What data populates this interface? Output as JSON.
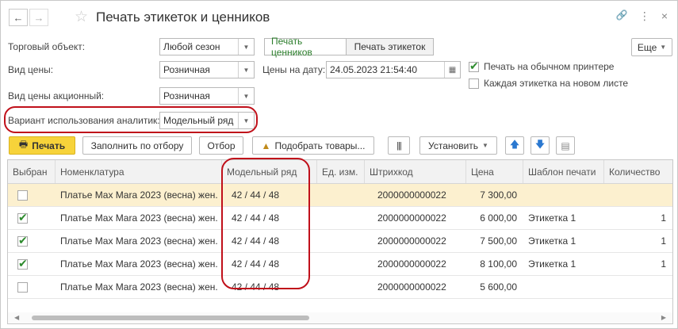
{
  "header": {
    "title": "Печать этикеток и ценников",
    "back": "←",
    "forward": "→",
    "star": "☆",
    "link": "🔗",
    "more": "⋮",
    "close": "×"
  },
  "form": {
    "trade_object_label": "Торговый объект:",
    "trade_object_value": "Любой сезон",
    "print_prices_label": "Печать ценников",
    "print_labels_label": "Печать этикеток",
    "more_label": "Еще",
    "price_type_label": "Вид цены:",
    "price_type_value": "Розничная",
    "prices_date_label": "Цены на дату:",
    "prices_date_value": "24.05.2023 21:54:40",
    "promo_price_label": "Вид цены акционный:",
    "promo_price_value": "Розничная",
    "print_normal_printer_label": "Печать на обычном принтере",
    "print_normal_printer_checked": true,
    "each_label_new_sheet_label": "Каждая этикетка на новом листе",
    "each_label_new_sheet_checked": false,
    "analytics_variant_label": "Вариант использования аналитик:",
    "analytics_variant_value": "Модельный ряд"
  },
  "toolbar": {
    "print_label": "Печать",
    "fill_label": "Заполнить по отбору",
    "filter_label": "Отбор",
    "pick_goods_label": "Подобрать товары...",
    "set_label": "Установить"
  },
  "table": {
    "columns": [
      "Выбран",
      "Номенклатура",
      "Модельный ряд",
      "Ед. изм.",
      "Штрихкод",
      "Цена",
      "Шаблон печати",
      "Количество"
    ],
    "rows": [
      {
        "selected": false,
        "name": "Платье Max Mara 2023 (весна) жен.",
        "model_range": "42 / 44 / 48",
        "unit": "",
        "barcode": "2000000000022",
        "price": "7 300,00",
        "template": "",
        "qty": ""
      },
      {
        "selected": true,
        "name": "Платье Max Mara 2023 (весна) жен.",
        "model_range": "42 / 44 / 48",
        "unit": "",
        "barcode": "2000000000022",
        "price": "6 000,00",
        "template": "Этикетка 1",
        "qty": "1"
      },
      {
        "selected": true,
        "name": "Платье Max Mara 2023 (весна) жен.",
        "model_range": "42 / 44 / 48",
        "unit": "",
        "barcode": "2000000000022",
        "price": "7 500,00",
        "template": "Этикетка 1",
        "qty": "1"
      },
      {
        "selected": true,
        "name": "Платье Max Mara 2023 (весна) жен.",
        "model_range": "42 / 44 / 48",
        "unit": "",
        "barcode": "2000000000022",
        "price": "8 100,00",
        "template": "Этикетка 1",
        "qty": "1"
      },
      {
        "selected": false,
        "name": "Платье Max Mara 2023 (весна) жен.",
        "model_range": "42 / 44 / 48",
        "unit": "",
        "barcode": "2000000000022",
        "price": "5 600,00",
        "template": "",
        "qty": ""
      }
    ]
  },
  "colors": {
    "accent_yellow": "#f7d33a",
    "highlight_red": "#c0101a",
    "selected_row": "#fcf0cf",
    "check_green": "#2e8b2e",
    "arrow_blue": "#2a78d0"
  }
}
